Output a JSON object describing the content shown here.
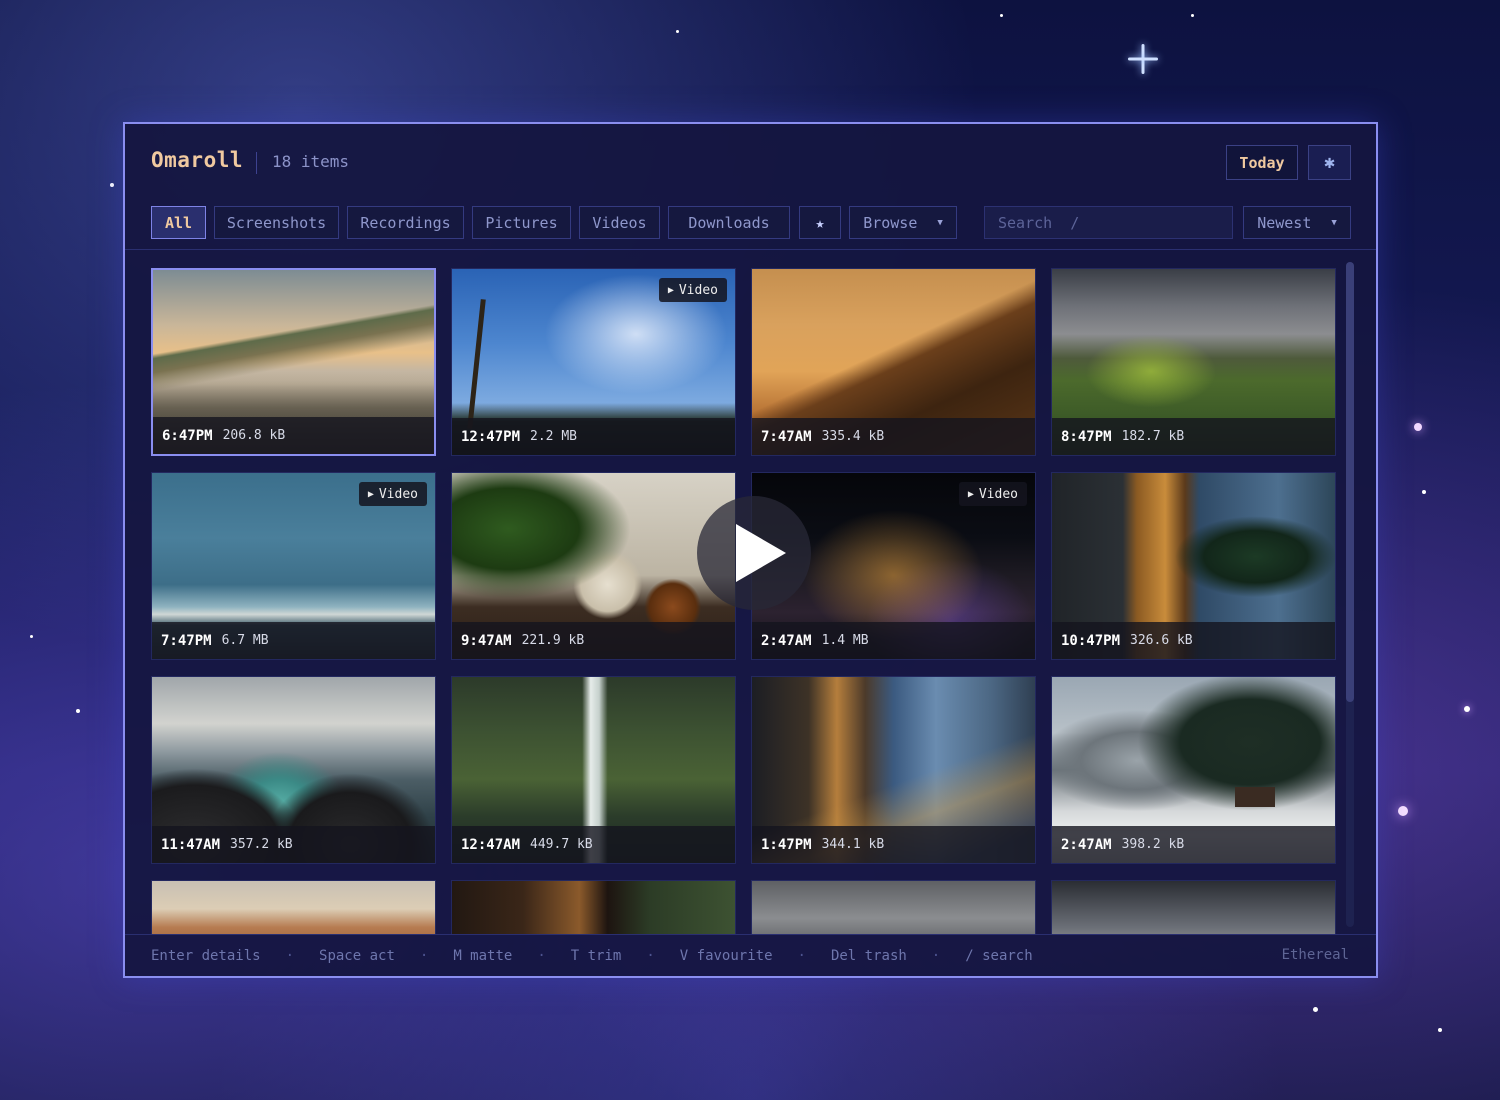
{
  "app": {
    "title": "Omaroll",
    "item_count": "18 items"
  },
  "header": {
    "today_label": "Today",
    "settings_icon": "gear-icon"
  },
  "filters": {
    "tabs": [
      "All",
      "Screenshots",
      "Recordings",
      "Pictures",
      "Videos",
      "Downloads"
    ],
    "active": "All",
    "favorite_icon": "star-icon",
    "favorite_glyph": "★",
    "browse_label": "Browse",
    "search_placeholder": "Search  /",
    "sort_label": "Newest"
  },
  "tiles": [
    {
      "time": "6:47PM",
      "size": "206.8 kB",
      "video": false,
      "selected": true,
      "scene": "misty-mountain-lake"
    },
    {
      "time": "12:47PM",
      "size": "2.2 MB",
      "video": true,
      "scene": "sky-dead-tree"
    },
    {
      "time": "7:47AM",
      "size": "335.4 kB",
      "video": false,
      "scene": "sand-dune"
    },
    {
      "time": "8:47PM",
      "size": "182.7 kB",
      "video": false,
      "scene": "green-hills-storm"
    },
    {
      "time": "7:47PM",
      "size": "6.7 MB",
      "video": true,
      "scene": "ocean-shore"
    },
    {
      "time": "9:47AM",
      "size": "221.9 kB",
      "video": false,
      "scene": "plant-vase"
    },
    {
      "time": "2:47AM",
      "size": "1.4 MB",
      "video": true,
      "scene": "night-city"
    },
    {
      "time": "10:47PM",
      "size": "326.6 kB",
      "video": false,
      "scene": "modern-house-tree"
    },
    {
      "time": "11:47AM",
      "size": "357.2 kB",
      "video": false,
      "scene": "waves-rocks"
    },
    {
      "time": "12:47AM",
      "size": "449.7 kB",
      "video": false,
      "scene": "forest-waterfall"
    },
    {
      "time": "1:47PM",
      "size": "344.1 kB",
      "video": false,
      "scene": "wet-city-street"
    },
    {
      "time": "2:47AM",
      "size": "398.2 kB",
      "video": false,
      "scene": "snowy-cabin"
    },
    {
      "scene": "canyon-partial"
    },
    {
      "scene": "interior-forest-partial"
    },
    {
      "scene": "clouds-partial"
    },
    {
      "scene": "cliff-sky-partial"
    }
  ],
  "video_badge_label": "Video",
  "video_badge_glyph": "▶",
  "footer": {
    "hints": [
      "Enter details",
      "Space act",
      "M matte",
      "T trim",
      "V favourite",
      "Del trash",
      "/ search"
    ],
    "theme": "Ethereal"
  },
  "colors": {
    "accent": "#8a8ef0",
    "title": "#f0c9a0",
    "window_bg": "#14163f"
  }
}
